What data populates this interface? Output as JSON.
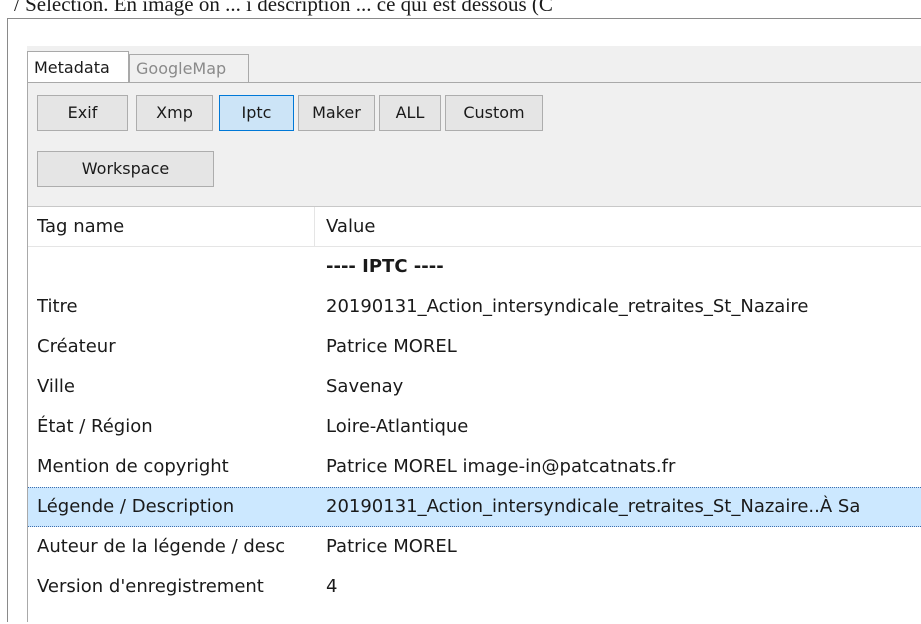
{
  "page": {
    "clipped_heading": "/ Sélection. En image on ... i description ... ce qui est dessous (C"
  },
  "tabs": [
    {
      "label": "Metadata",
      "active": true
    },
    {
      "label": "GoogleMap",
      "active": false
    }
  ],
  "filters": [
    {
      "label": "Exif",
      "selected": false
    },
    {
      "label": "Xmp",
      "selected": false
    },
    {
      "label": "Iptc",
      "selected": true
    },
    {
      "label": "Maker",
      "selected": false
    },
    {
      "label": "ALL",
      "selected": false
    },
    {
      "label": "Custom",
      "selected": false
    }
  ],
  "workspace_label": "Workspace",
  "table": {
    "headers": [
      "Tag name",
      "Value"
    ],
    "section_label": "---- IPTC ----",
    "rows": [
      {
        "tag": "Titre",
        "value": "20190131_Action_intersyndicale_retraites_St_Nazaire"
      },
      {
        "tag": "Créateur",
        "value": "Patrice MOREL"
      },
      {
        "tag": "Ville",
        "value": "Savenay"
      },
      {
        "tag": "État / Région",
        "value": "Loire-Atlantique"
      },
      {
        "tag": "Mention de copyright",
        "value": "Patrice MOREL image-in@patcatnats.fr"
      },
      {
        "tag": "Légende / Description",
        "value": "20190131_Action_intersyndicale_retraites_St_Nazaire..À Sa"
      },
      {
        "tag": "Auteur de la légende / desc",
        "value": "Patrice MOREL"
      },
      {
        "tag": "Version d'enregistrement",
        "value": "4"
      }
    ],
    "selected_row_index": 5
  },
  "colors": {
    "selection_bg": "#cce8ff",
    "button_selected_bg": "#cce4f7",
    "button_selected_border": "#0078d7"
  }
}
